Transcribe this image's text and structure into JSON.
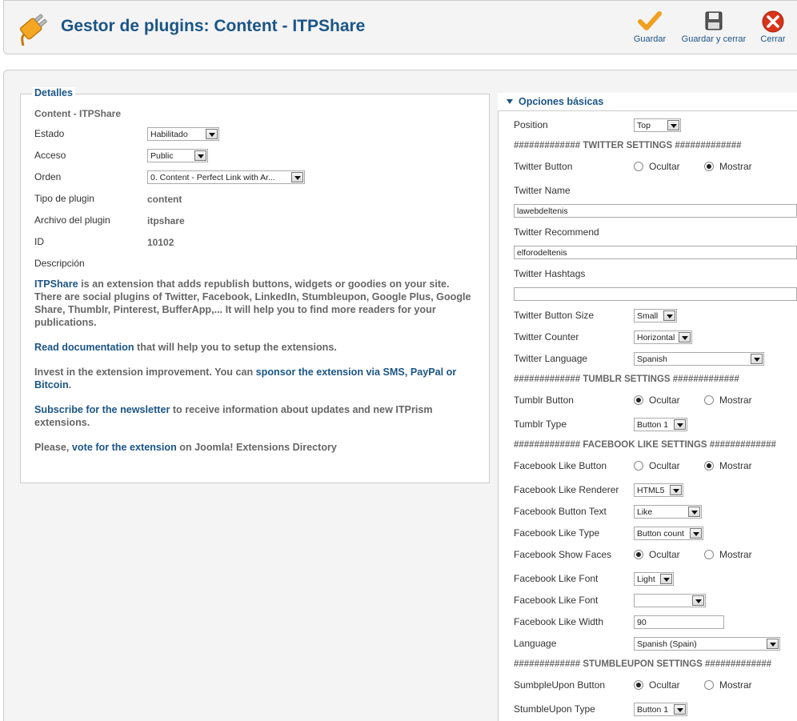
{
  "header": {
    "title": "Gestor de plugins: Content - ITPShare",
    "plugin_icon": "plug-icon",
    "save_label": "Guardar",
    "save_close_label": "Guardar y cerrar",
    "close_label": "Cerrar",
    "colors": {
      "title": "#1a5587",
      "save": "#f0a020",
      "close": "#d9331a"
    }
  },
  "details": {
    "legend": "Detalles",
    "subtitle": "Content - ITPShare",
    "estado_label": "Estado",
    "estado_value": "Habilitado",
    "acceso_label": "Acceso",
    "acceso_value": "Public",
    "orden_label": "Orden",
    "orden_value": "0. Content - Perfect Link with Ar...",
    "tipo_label": "Tipo de plugin",
    "tipo_value": "content",
    "archivo_label": "Archivo del plugin",
    "archivo_value": "itpshare",
    "id_label": "ID",
    "id_value": "10102",
    "descripcion_label": "Descripción",
    "desc": {
      "p1_link": "ITPShare",
      "p1_text": " is an extension that adds republish buttons, widgets or goodies on your site. There are social plugins of Twitter, Facebook, LinkedIn, Stumbleupon, Google Plus, Google Share, Thumblr, Pinterest, BufferApp,... It will help you to find more readers for your publications.",
      "p2_link": "Read documentation",
      "p2_text": " that will help you to setup the extensions.",
      "p3_text": "Invest in the extension improvement. You can ",
      "p3_link": "sponsor the extension via SMS, PayPal or Bitcoin",
      "p3_end": ".",
      "p4_link": "Subscribe for the newsletter",
      "p4_text": " to receive information about updates and new ITPrism extensions.",
      "p5_text": "Please, ",
      "p5_link": "vote for the extension",
      "p5_end": " on Joomla! Extensions Directory"
    }
  },
  "options": {
    "header": "Opciones básicas",
    "position_label": "Position",
    "position_value": "Top",
    "twitter_sep": "############# TWITTER SETTINGS #############",
    "twitter_button_label": "Twitter Button",
    "twitter_name_label": "Twitter Name",
    "twitter_name_value": "lawebdeltenis",
    "twitter_recommend_label": "Twitter Recommend",
    "twitter_recommend_value": "elforodeltenis",
    "twitter_hashtags_label": "Twitter Hashtags",
    "twitter_hashtags_value": "",
    "twitter_size_label": "Twitter Button Size",
    "twitter_size_value": "Small",
    "twitter_counter_label": "Twitter Counter",
    "twitter_counter_value": "Horizontal",
    "twitter_language_label": "Twitter Language",
    "twitter_language_value": "Spanish",
    "tumblr_sep": "############# TUMBLR SETTINGS #############",
    "tumblr_button_label": "Tumblr Button",
    "tumblr_type_label": "Tumblr Type",
    "tumblr_type_value": "Button 1",
    "facebook_sep": "############# FACEBOOK LIKE SETTINGS #############",
    "fb_button_label": "Facebook Like Button",
    "fb_renderer_label": "Facebook Like Renderer",
    "fb_renderer_value": "HTML5",
    "fb_text_label": "Facebook Button Text",
    "fb_text_value": "Like",
    "fb_type_label": "Facebook Like Type",
    "fb_type_value": "Button count",
    "fb_faces_label": "Facebook Show Faces",
    "fb_font1_label": "Facebook Like Font",
    "fb_font1_value": "Light",
    "fb_font2_label": "Facebook Like Font",
    "fb_font2_value": "",
    "fb_width_label": "Facebook Like Width",
    "fb_width_value": "90",
    "language_label": "Language",
    "language_value": "Spanish (Spain)",
    "stumble_sep": "############# STUMBLEUPON SETTINGS #############",
    "stumble_button_label": "SumbpleUpon Button",
    "stumble_type_label": "StumbleUpon Type",
    "stumble_type_value": "Button 1",
    "ocultar": "Ocultar",
    "mostrar": "Mostrar"
  }
}
